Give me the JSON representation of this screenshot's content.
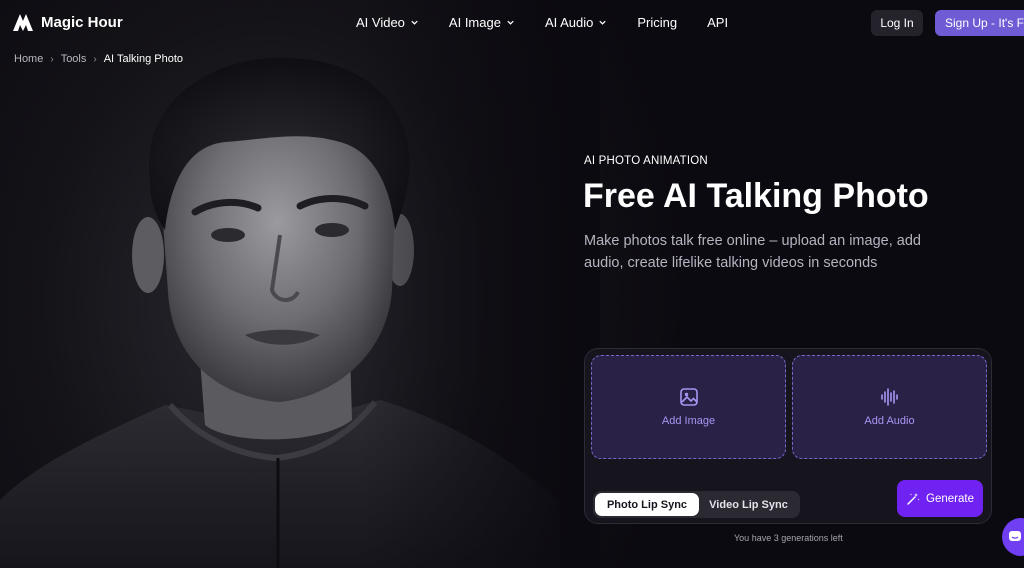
{
  "brand": {
    "name": "Magic Hour"
  },
  "nav": {
    "items": [
      {
        "label": "AI Video",
        "has_dropdown": true
      },
      {
        "label": "AI Image",
        "has_dropdown": true
      },
      {
        "label": "AI Audio",
        "has_dropdown": true
      },
      {
        "label": "Pricing",
        "has_dropdown": false
      },
      {
        "label": "API",
        "has_dropdown": false
      }
    ],
    "login_label": "Log In",
    "signup_label": "Sign Up  - It's Free"
  },
  "breadcrumb": [
    "Home",
    "Tools",
    "AI Talking Photo"
  ],
  "hero": {
    "eyebrow": "AI PHOTO ANIMATION",
    "title": "Free AI Talking Photo",
    "subtitle": "Make photos talk free online – upload an image, add audio, create lifelike talking videos in seconds"
  },
  "upload": {
    "image_label": "Add Image",
    "image_icon": "image-icon",
    "audio_label": "Add Audio",
    "audio_icon": "audio-wave-icon",
    "modes": [
      "Photo Lip Sync",
      "Video Lip Sync"
    ],
    "active_mode": "Photo Lip Sync",
    "generate_label": "Generate",
    "generate_icon": "magic-wand-icon",
    "remaining_text": "You have 3 generations left"
  },
  "colors": {
    "background": "#0b0a10",
    "accent": "#6f5bd3",
    "generate": "#6f22f2",
    "dropzone": "#2a2147",
    "dropzone_text": "#a995f2"
  },
  "chat": {
    "icon": "chat-icon"
  }
}
